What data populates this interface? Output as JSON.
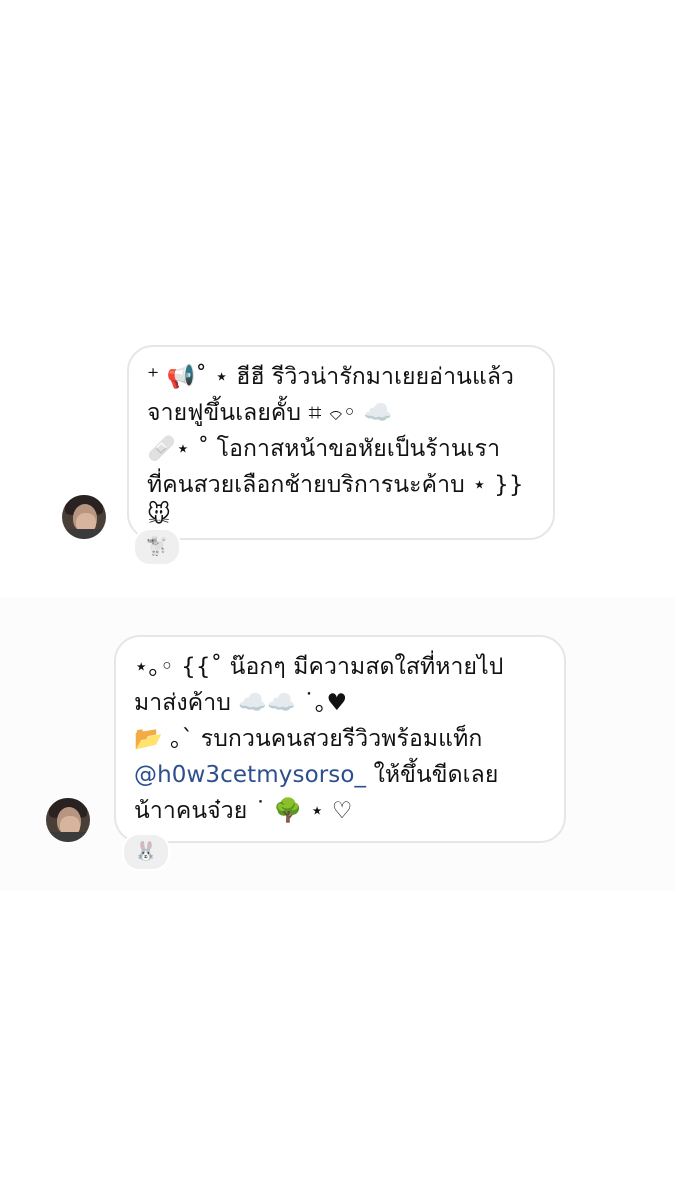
{
  "messages": [
    {
      "lines": [
        "⁺ 📢˚ ⋆ ฮีฮี รีวิวน่ารักมาเยยอ่านแล้ว",
        "จายฟูขึ้นเลยคั้บ ⌗ ⌔◦ ☁️",
        "🩹⋆ ˚ โอกาสหน้าขอหัยเป็นร้านเรา",
        "ที่คนสวยเลือกช้ายบริการนะค้าบ ⋆ }}",
        "🐭"
      ],
      "reaction": "🐩"
    },
    {
      "lines": [
        "⋆｡◦ {{˚ น๊อกๆ มีความสดใสที่หายไป",
        "มาส่งค้าบ ☁️☁️ ˙｡♥",
        "📂 ｡` รบกวนคนสวยรีวิวพร้อมแท็ก",
        "",
        "น้าาคนจ๋วย ˙ 🌳 ⋆ ♡"
      ],
      "mention": "@h0w3cetmysorso_",
      "mention_suffix": "  ให้ขึ้นขีดเลย",
      "reaction": "🐰"
    }
  ],
  "avatar_icon": "profile-avatar"
}
